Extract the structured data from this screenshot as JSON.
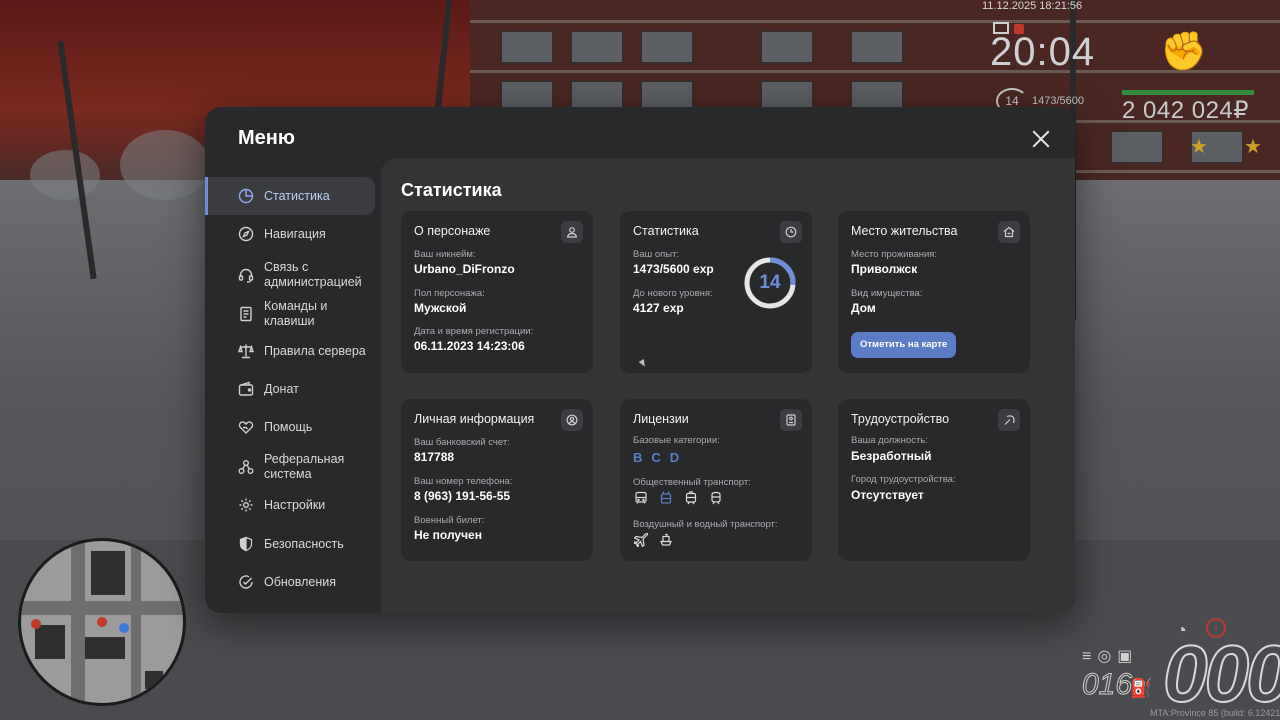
{
  "hud": {
    "datetime": "11.12.2025 18:21:56",
    "clock": "20:04",
    "level": "14",
    "exp": "1473/5600",
    "money": "2 042 024₽",
    "speed": "000",
    "fuel": "016",
    "build": "MTA:Province 85 (build: 6.12421.5)"
  },
  "menu": {
    "title": "Меню",
    "sidebar": [
      {
        "label": "Статистика",
        "icon": "pie-chart-icon",
        "active": true
      },
      {
        "label": "Навигация",
        "icon": "compass-icon"
      },
      {
        "label": "Связь с\nадминистрацией",
        "icon": "headset-icon"
      },
      {
        "label": "Команды и\nклавиши",
        "icon": "document-icon"
      },
      {
        "label": "Правила сервера",
        "icon": "scales-icon"
      },
      {
        "label": "Донат",
        "icon": "wallet-icon"
      },
      {
        "label": "Помощь",
        "icon": "heart-hand-icon"
      },
      {
        "label": "Реферальная\nсистема",
        "icon": "network-icon"
      },
      {
        "label": "Настройки",
        "icon": "gear-icon"
      },
      {
        "label": "Безопасность",
        "icon": "shield-icon"
      },
      {
        "label": "Обновления",
        "icon": "check-circle-icon"
      }
    ]
  },
  "content": {
    "title": "Статистика",
    "character": {
      "title": "О персонаже",
      "nickname_label": "Ваш никнейм:",
      "nickname": "Urbano_DiFronzo",
      "gender_label": "Пол персонажа:",
      "gender": "Мужской",
      "reg_label": "Дата и время регистрации:",
      "reg": "06.11.2023 14:23:06"
    },
    "stats": {
      "title": "Статистика",
      "exp_label": "Ваш опыт:",
      "exp": "1473/5600 exp",
      "next_label": "До нового уровня:",
      "next": "4127 exp",
      "level": "14",
      "progress": 0.263,
      "accent": "#6d8ed8"
    },
    "residence": {
      "title": "Место жительства",
      "place_label": "Место проживания:",
      "place": "Приволжск",
      "property_label": "Вид имущества:",
      "property": "Дом",
      "map_button": "Отметить на карте"
    },
    "personal": {
      "title": "Личная информация",
      "bank_label": "Ваш банковский счет:",
      "bank": "817788",
      "phone_label": "Ваш номер телефона:",
      "phone": "8 (963) 191-56-55",
      "military_label": "Военный билет:",
      "military": "Не получен"
    },
    "licenses": {
      "title": "Лицензии",
      "base_label": "Базовые категории:",
      "categories": [
        "B",
        "C",
        "D"
      ],
      "public_label": "Общественный транспорт:",
      "public_icons": [
        "bus-icon",
        "trolleybus-icon",
        "tram-icon",
        "train-icon"
      ],
      "air_label": "Воздушный и водный транспорт:",
      "air_icons": [
        "plane-icon",
        "boat-icon"
      ]
    },
    "job": {
      "title": "Трудоустройство",
      "position_label": "Ваша должность:",
      "position": "Безработный",
      "city_label": "Город трудоустройства:",
      "city": "Отсутствует"
    }
  }
}
